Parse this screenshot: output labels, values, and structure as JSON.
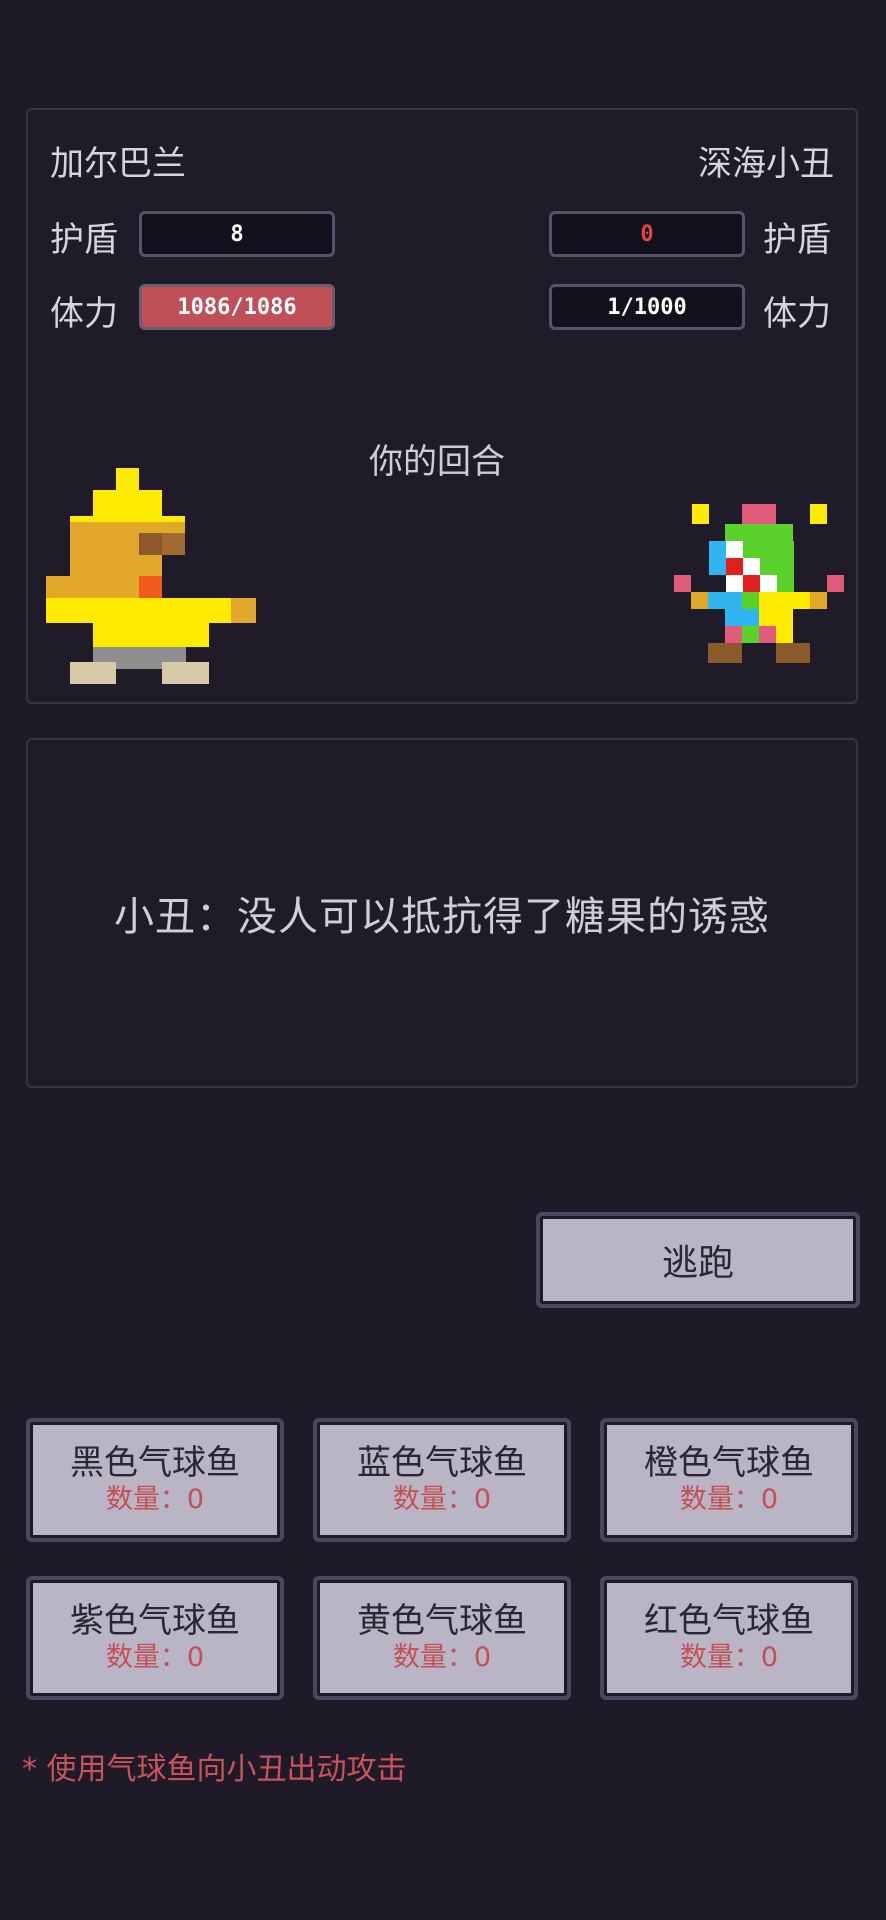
{
  "player": {
    "name": "加尔巴兰",
    "shield_label": "护盾",
    "shield_value": "8",
    "hp_label": "体力",
    "hp_value": "1086/1086",
    "sprite": "bird-hero-sprite"
  },
  "enemy": {
    "name": "深海小丑",
    "shield_label": "护盾",
    "shield_value": "0",
    "hp_label": "体力",
    "hp_value": "1/1000",
    "sprite": "clown-sprite"
  },
  "turn_text": "你的回合",
  "dialog": "小丑：没人可以抵抗得了糖果的诱惑",
  "flee_label": "逃跑",
  "fish_items": [
    {
      "name": "黑色气球鱼",
      "count": "数量：0"
    },
    {
      "name": "蓝色气球鱼",
      "count": "数量：0"
    },
    {
      "name": "橙色气球鱼",
      "count": "数量：0"
    },
    {
      "name": "紫色气球鱼",
      "count": "数量：0"
    },
    {
      "name": "黄色气球鱼",
      "count": "数量：0"
    },
    {
      "name": "红色气球鱼",
      "count": "数量：0"
    }
  ],
  "hint": "* 使用气球鱼向小丑出动攻击",
  "colors": {
    "background": "#1e1a28",
    "button": "#b9b5c4",
    "hp_bar": "#c05058",
    "warning_text": "#c8535a"
  }
}
